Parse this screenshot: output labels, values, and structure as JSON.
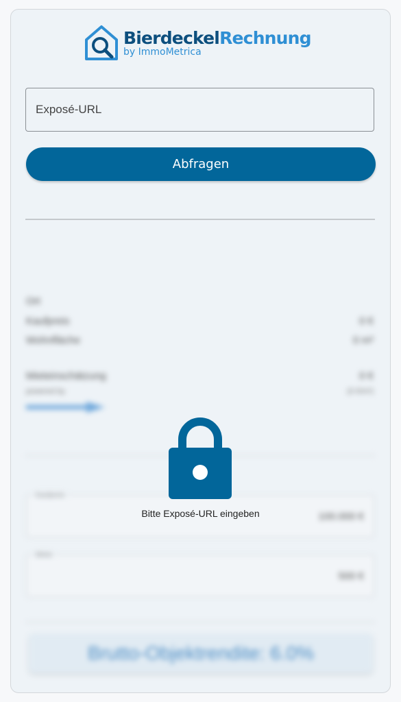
{
  "brand": {
    "name_part1": "Bierdeckel",
    "name_part2": "Rechnung",
    "subtitle": "by ImmoMetrica",
    "color_dark": "#0d4f7e",
    "color_light": "#2f8fd4"
  },
  "form": {
    "url_placeholder": "Exposé-URL",
    "query_label": "Abfragen",
    "button_color": "#02669a"
  },
  "results_blurred": {
    "ort_label": "Ort",
    "kaufpreis_label": "Kaufpreis",
    "kaufpreis_value": "0 €",
    "wohnflaeche_label": "Wohnfläche",
    "wohnflaeche_value": "0 m²",
    "mieteinschaetzung_label": "Mieteinschätzung",
    "mieteinschaetzung_value": "0 €",
    "powered_by": "powered by",
    "per_month": "(0 €/m²)",
    "kaufpreis_box_label": "Kaufpreis",
    "kaufpreis_box_value": "100.000 €",
    "miete_box_label": "Miete",
    "miete_box_value": "500 €",
    "rendite_text": "Brutto-Objektrendite: 6.0%"
  },
  "lock_overlay": {
    "icon": "lock-icon",
    "message": "Bitte Exposé-URL eingeben",
    "color": "#02669a"
  }
}
